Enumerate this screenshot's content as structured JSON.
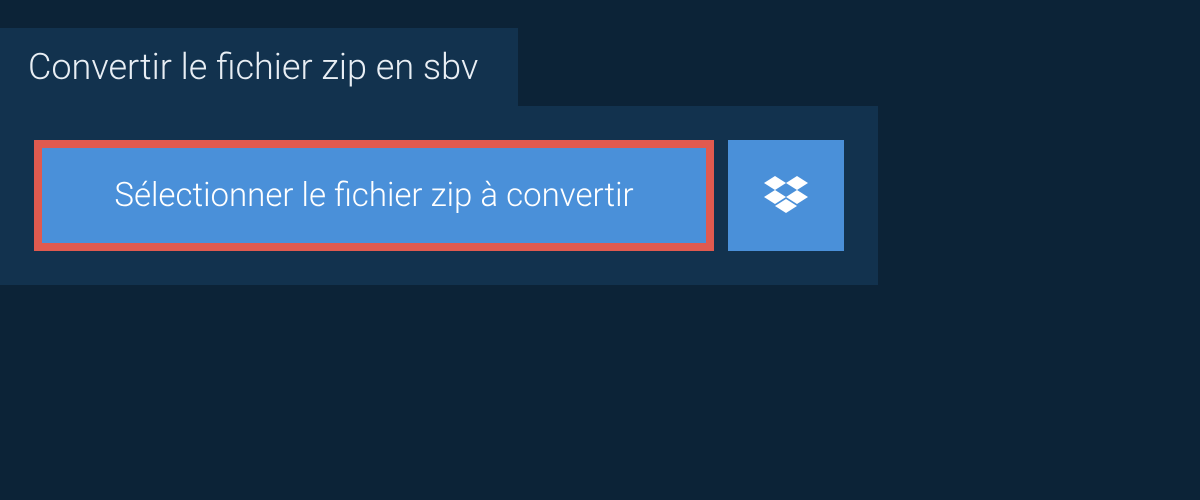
{
  "tab": {
    "title": "Convertir le fichier zip en sbv"
  },
  "actions": {
    "select_label": "Sélectionner le fichier zip à convertir"
  },
  "colors": {
    "background": "#0c2337",
    "panel": "#12324e",
    "button": "#4a90d9",
    "highlight_border": "#e05a4f"
  }
}
